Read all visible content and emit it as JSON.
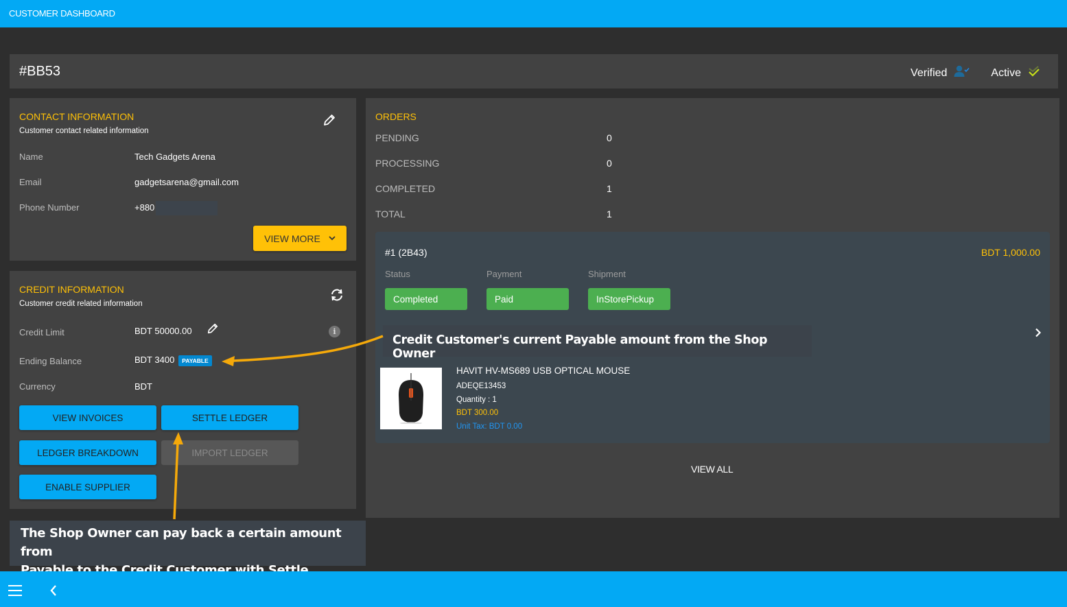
{
  "app": {
    "title": "CUSTOMER DASHBOARD"
  },
  "header": {
    "customer_id": "#BB53",
    "statuses": [
      {
        "label": "Verified",
        "icon": "user-verified-icon",
        "color": "#1e88e5"
      },
      {
        "label": "Active",
        "icon": "double-check-icon",
        "color": "#c6e01a"
      }
    ]
  },
  "contact": {
    "title": "CONTACT INFORMATION",
    "subtitle": "Customer contact related information",
    "fields": [
      {
        "label": "Name",
        "value": "Tech Gadgets Arena"
      },
      {
        "label": "Email",
        "value": "gadgetsarena@gmail.com"
      },
      {
        "label": "Phone Number",
        "value": "+880"
      }
    ],
    "view_more_label": "VIEW MORE"
  },
  "credit": {
    "title": "CREDIT INFORMATION",
    "subtitle": "Customer credit related information",
    "fields": [
      {
        "label": "Credit Limit",
        "value": "BDT 50000.00"
      },
      {
        "label": "Ending Balance",
        "value": "BDT 3400",
        "badge": "PAYABLE"
      },
      {
        "label": "Currency",
        "value": "BDT"
      }
    ],
    "buttons": {
      "view_invoices": "VIEW INVOICES",
      "settle_ledger": "SETTLE LEDGER",
      "ledger_breakdown": "LEDGER BREAKDOWN",
      "import_ledger": "IMPORT LEDGER",
      "enable_supplier": "ENABLE SUPPLIER"
    }
  },
  "orders": {
    "title": "ORDERS",
    "stats": [
      {
        "label": "PENDING",
        "value": "0"
      },
      {
        "label": "PROCESSING",
        "value": "0"
      },
      {
        "label": "COMPLETED",
        "value": "1"
      },
      {
        "label": "TOTAL",
        "value": "1"
      }
    ],
    "items": [
      {
        "id": "#1 (2B43)",
        "total": "BDT 1,000.00",
        "status_label": "Status",
        "status": "Completed",
        "payment_label": "Payment",
        "payment": "Paid",
        "shipment_label": "Shipment",
        "shipment": "InStorePickup",
        "product": {
          "name": "HAVIT HV-MS689 USB OPTICAL MOUSE",
          "sku": "ADEQE13453",
          "quantity": "Quantity : 1",
          "price": "BDT 300.00",
          "unit_tax": "Unit Tax: BDT 0.00"
        }
      }
    ],
    "view_all_label": "VIEW ALL"
  },
  "annotations": {
    "payable_callout": "Credit Customer's current Payable amount from the Shop Owner",
    "settle_callout_line1": "The Shop Owner can pay back a certain amount from",
    "settle_callout_line2": "Payable to the Credit Customer with Settle Ledger",
    "arrow_color": "#f5a90a"
  }
}
